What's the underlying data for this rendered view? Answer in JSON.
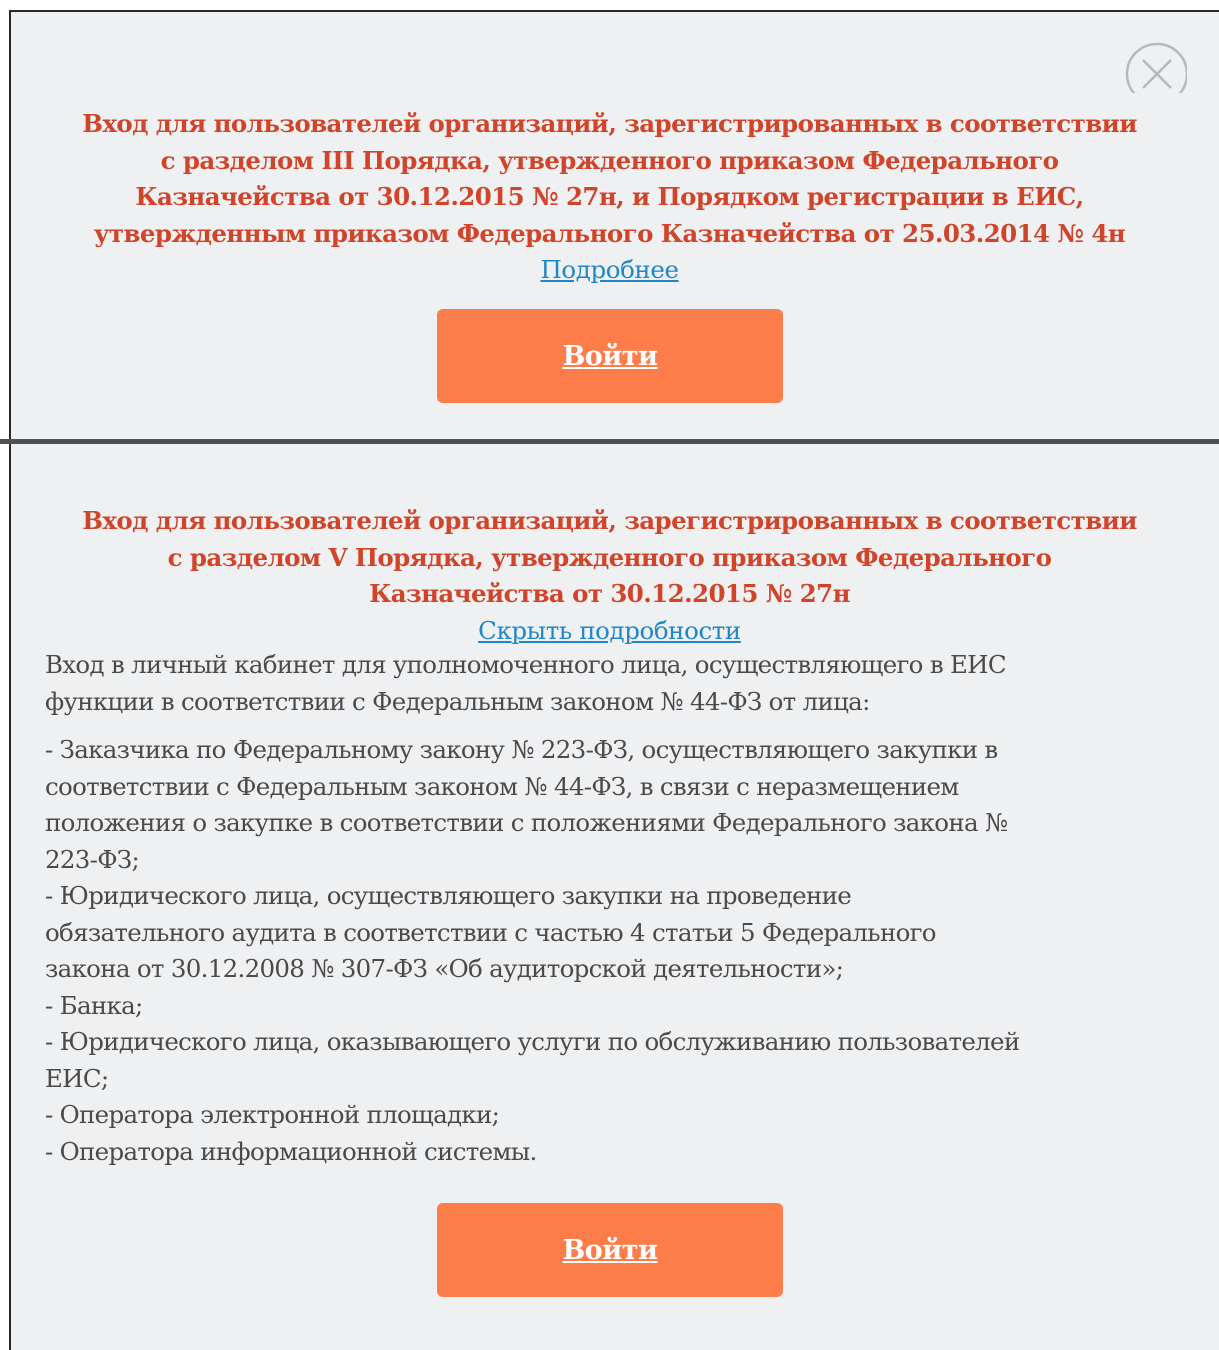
{
  "close_icon_name": "close-icon",
  "section1": {
    "title": "Вход для пользователей организаций, зарегистрированных в соответствии\nс разделом III Порядка, утвержденного приказом Федерального\nКазначейства от 30.12.2015 № 27н, и Порядком регистрации в ЕИС,\nутвержденным приказом Федерального Казначейства от 25.03.2014 № 4н",
    "details_link": "Подробнее",
    "login_button": "Войти"
  },
  "section2": {
    "title": "Вход для пользователей организаций, зарегистрированных в соответствии\nс разделом V Порядка, утвержденного приказом Федерального\nКазначейства от 30.12.2015 № 27н",
    "details_link": "Скрыть подробности",
    "intro": "Вход в личный кабинет для уполномоченного лица, осуществляющего в ЕИС\nфункции в соответствии с Федеральным законом № 44-ФЗ от лица:",
    "list": "- Заказчика по Федеральному закону № 223-ФЗ, осуществляющего закупки в\nсоответствии с Федеральным законом № 44-ФЗ, в связи с неразмещением\nположения о закупке в соответствии с положениями Федерального закона №\n223-ФЗ;\n- Юридического лица, осуществляющего закупки на проведение\nобязательного аудита в соответствии с частью 4 статьи 5 Федерального\nзакона от 30.12.2008 № 307-ФЗ «Об аудиторской деятельности»;\n- Банка;\n- Юридического лица, оказывающего услуги по обслуживанию пользователей\nЕИС;\n- Оператора электронной площадки;\n- Оператора информационной системы.",
    "login_button": "Войти"
  },
  "colors": {
    "title": "#d0452a",
    "link": "#1f86c7",
    "button": "#fc7c4a",
    "background": "#eff0f2",
    "text": "#4a4a4a"
  }
}
